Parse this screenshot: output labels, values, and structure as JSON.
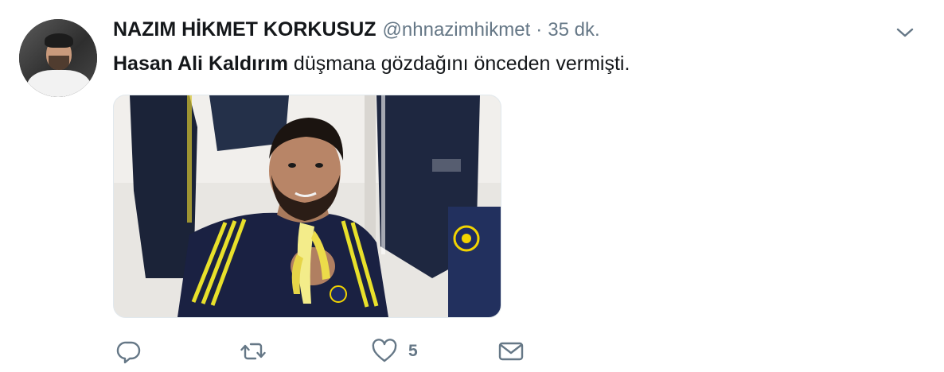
{
  "tweet": {
    "author_name": "NAZIM HİKMET KORKUSUZ",
    "handle": "@nhnazimhikmet",
    "separator": "·",
    "time": "35 dk.",
    "text_bold": "Hasan Ali Kaldırım",
    "text_rest": " düşmana gözdağını önceden vermişti.",
    "actions": {
      "like_count": "5"
    }
  },
  "icons": {
    "caret": "chevron-down-icon",
    "reply": "reply-icon",
    "retweet": "retweet-icon",
    "like": "heart-icon",
    "dm": "envelope-icon"
  },
  "colors": {
    "text": "#14171a",
    "secondary": "#657786",
    "border": "#e1e8ed"
  }
}
